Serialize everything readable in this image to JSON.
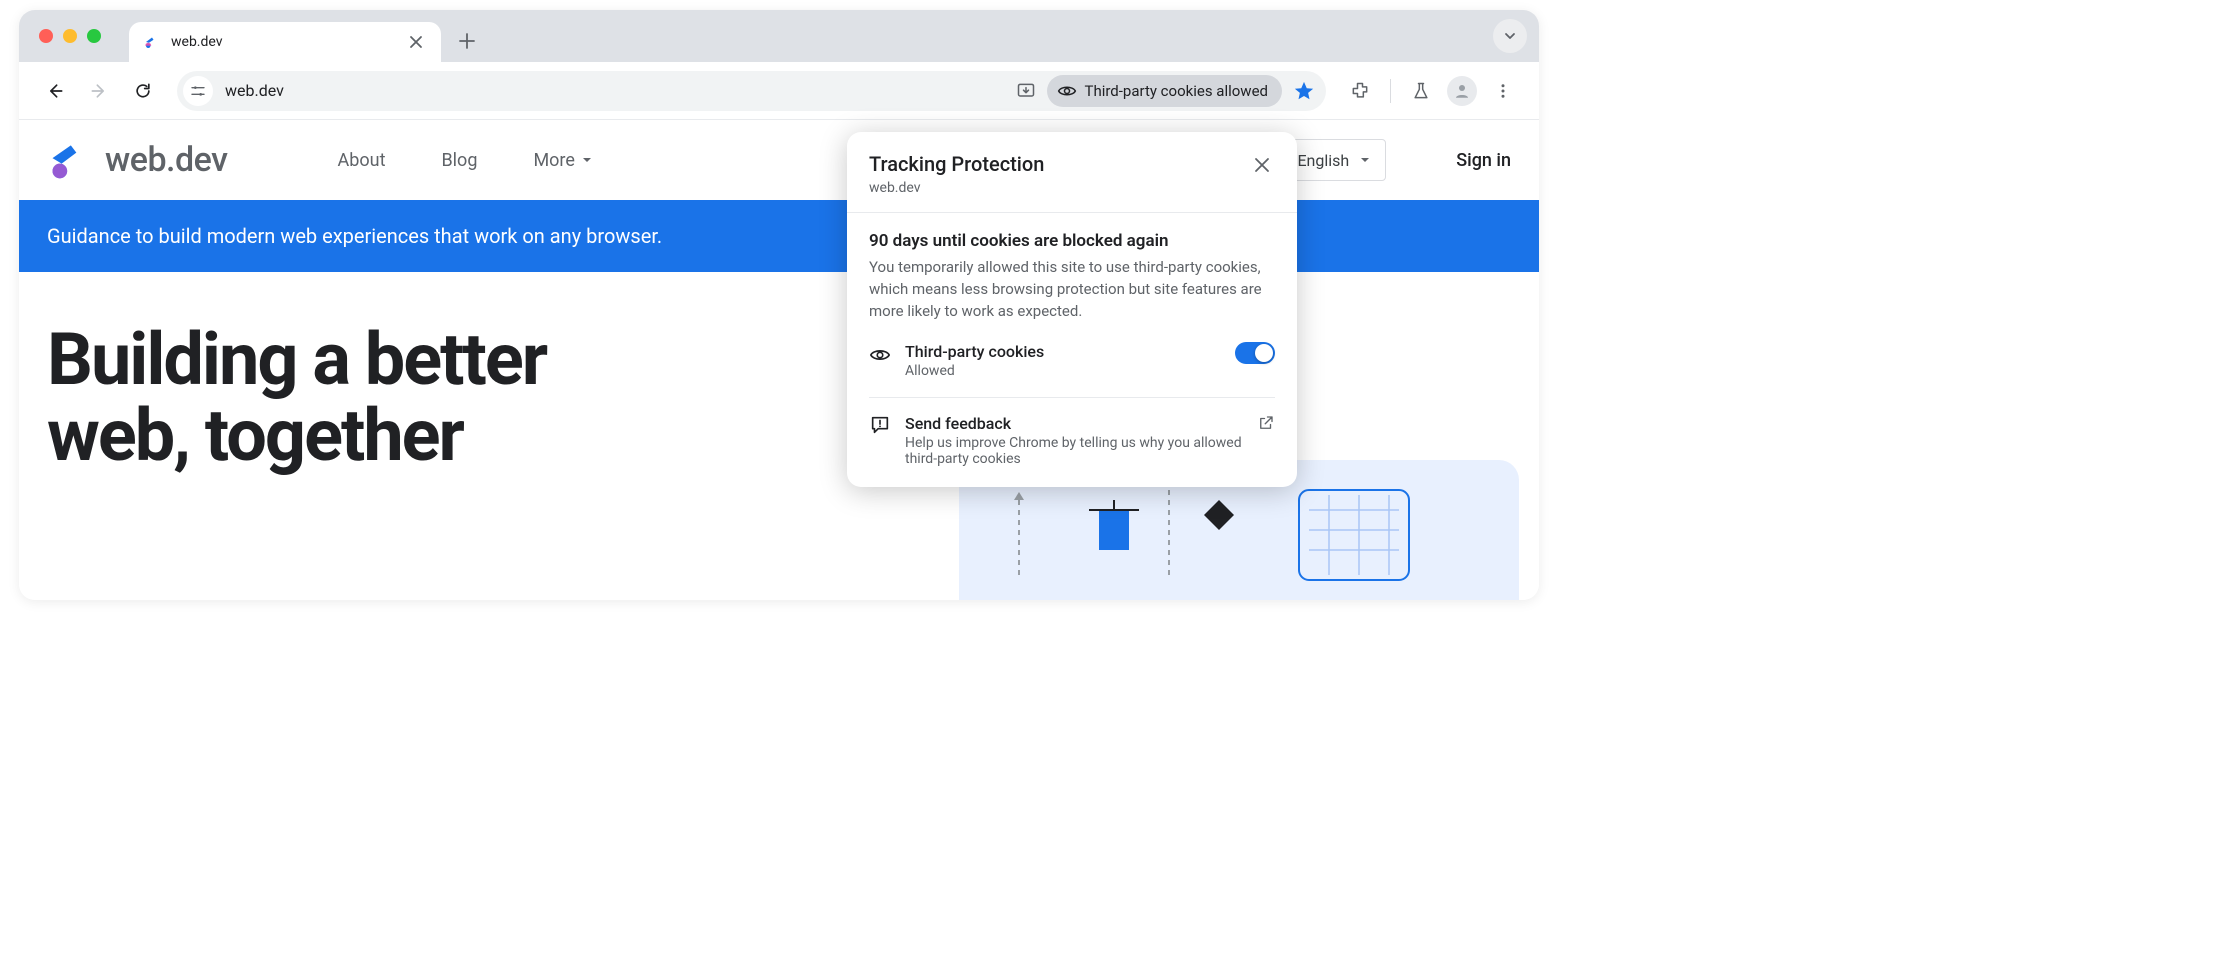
{
  "tab": {
    "title": "web.dev"
  },
  "omnibox": {
    "url": "web.dev"
  },
  "cookie_chip": {
    "label": "Third-party cookies allowed"
  },
  "site": {
    "logo_text": "web.dev",
    "nav": {
      "about": "About",
      "blog": "Blog",
      "more": "More"
    },
    "language": "English",
    "signin": "Sign in",
    "banner": "Guidance to build modern web experiences that work on any browser.",
    "hero_line1": "Building a better",
    "hero_line2": "web, together"
  },
  "popover": {
    "title": "Tracking Protection",
    "site": "web.dev",
    "heading": "90 days until cookies are blocked again",
    "desc": "You temporarily allowed this site to use third-party cookies, which means less browsing protection but site features are more likely to work as expected.",
    "row_title": "Third-party cookies",
    "row_status": "Allowed",
    "feedback_title": "Send feedback",
    "feedback_desc": "Help us improve Chrome by telling us why you allowed third-party cookies"
  }
}
